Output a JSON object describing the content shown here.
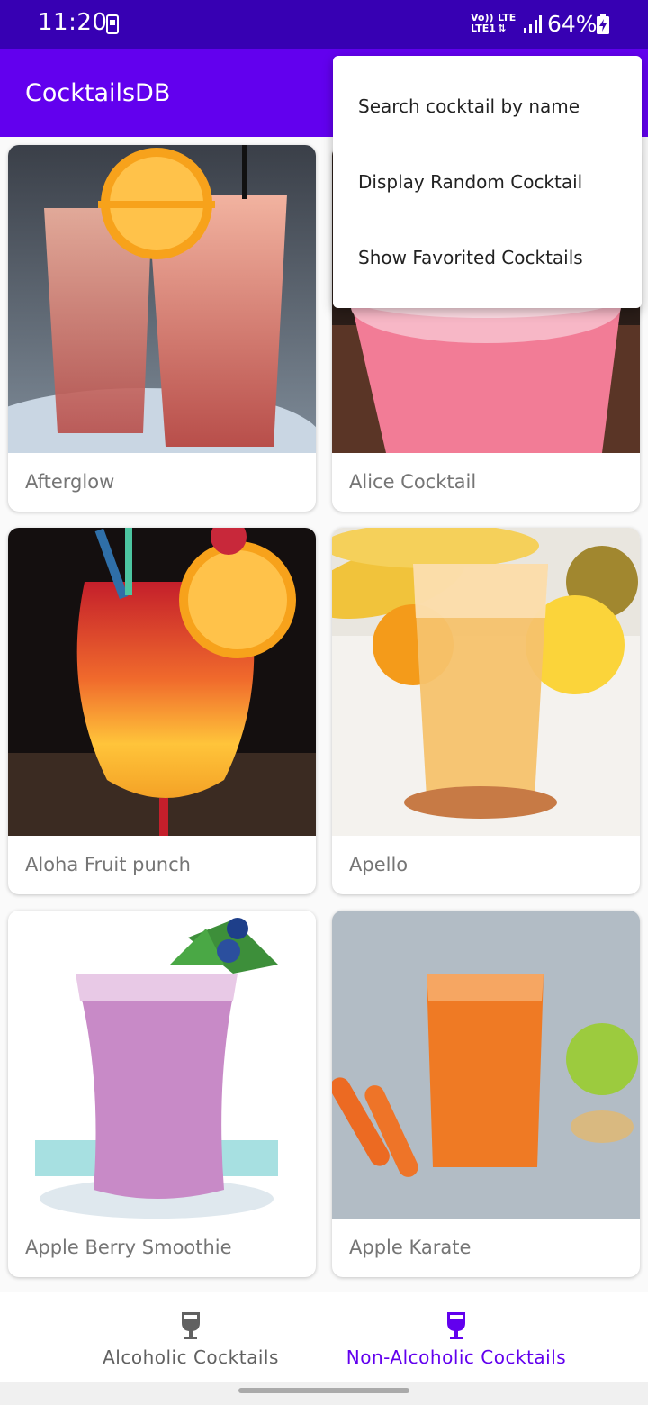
{
  "status_bar": {
    "time": "11:20",
    "network_top": "Vo))",
    "network_bottom": "LTE1",
    "lte_label": "LTE",
    "battery": "64%"
  },
  "app_bar": {
    "title": "CocktailsDB"
  },
  "overflow_menu": {
    "items": [
      {
        "label": "Search cocktail by name"
      },
      {
        "label": "Display Random Cocktail"
      },
      {
        "label": "Show Favorited Cocktails"
      }
    ]
  },
  "cocktails": [
    {
      "name": "Afterglow"
    },
    {
      "name": "Alice Cocktail"
    },
    {
      "name": "Aloha Fruit punch"
    },
    {
      "name": "Apello"
    },
    {
      "name": "Apple Berry Smoothie"
    },
    {
      "name": "Apple Karate"
    }
  ],
  "bottom_nav": {
    "items": [
      {
        "label": "Alcoholic Cocktails",
        "icon": "wine-glass-icon",
        "selected": false
      },
      {
        "label": "Non-Alcoholic Cocktails",
        "icon": "wine-glass-icon",
        "selected": true
      }
    ]
  },
  "colors": {
    "status_bar": "#3700b3",
    "app_bar": "#6200ee",
    "nav_selected": "#6200ee",
    "nav_unselected": "#616161"
  }
}
